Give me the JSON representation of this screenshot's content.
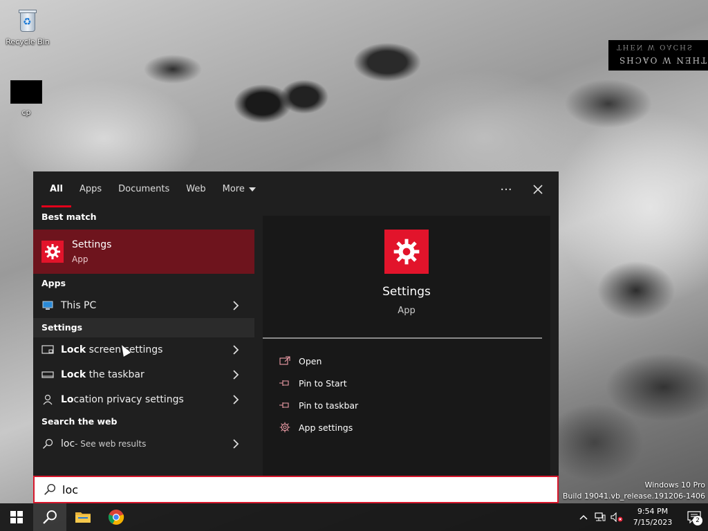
{
  "desktop": {
    "icons": [
      {
        "label": "Recycle Bin"
      },
      {
        "label": "cp"
      }
    ],
    "watermark": {
      "line1": "THEN W OACHS",
      "line2": "THEN W OACHS"
    },
    "os_text": {
      "edition": "Windows 10 Pro",
      "build": "Build 19041.vb_release.191206-1406"
    }
  },
  "search_panel": {
    "tabs": [
      {
        "label": "All",
        "active": true
      },
      {
        "label": "Apps"
      },
      {
        "label": "Documents"
      },
      {
        "label": "Web"
      },
      {
        "label": "More"
      }
    ],
    "more_options_label": "···",
    "close_label": "✕",
    "sections": {
      "best_match": "Best match",
      "apps": "Apps",
      "settings": "Settings",
      "search_web": "Search the web"
    },
    "best_match": {
      "title": "Settings",
      "subtitle": "App"
    },
    "apps": [
      {
        "label": "This PC"
      }
    ],
    "settings_results": [
      {
        "bold": "Lock",
        "rest": " screen settings"
      },
      {
        "bold": "Lock",
        "rest": " the taskbar"
      },
      {
        "bold": "Lo",
        "rest": "cation privacy settings"
      }
    ],
    "web_result": {
      "query": "loc",
      "suffix": " - See web results"
    },
    "preview": {
      "title": "Settings",
      "subtitle": "App",
      "actions": [
        {
          "label": "Open",
          "icon": "open-icon"
        },
        {
          "label": "Pin to Start",
          "icon": "pin-icon"
        },
        {
          "label": "Pin to taskbar",
          "icon": "pin-icon"
        },
        {
          "label": "App settings",
          "icon": "gear-icon"
        }
      ]
    }
  },
  "search_box": {
    "value": "loc"
  },
  "taskbar": {
    "clock": {
      "time": "9:54 PM",
      "date": "7/15/2023"
    },
    "notification_count": "2"
  },
  "colors": {
    "accent": "#e2142b",
    "selected_bg": "#6e141d",
    "panel_bg": "#1f1f1f"
  }
}
